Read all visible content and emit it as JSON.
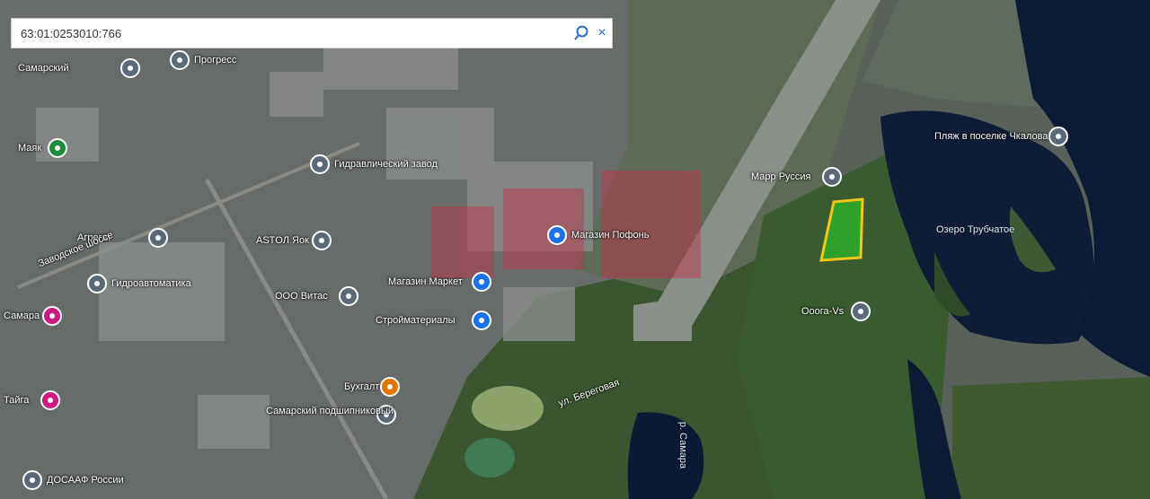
{
  "search": {
    "value": "63:01:0253010:766",
    "clear_symbol": "×"
  },
  "colors": {
    "water": "#0d1d3a",
    "forest": "#2e4a28",
    "industrial": "#6e7376",
    "runway": "#8a8f8a",
    "parcel_fill": "#2fa12a",
    "parcel_border": "#f2c618",
    "watermark": "#c4304a"
  },
  "pois": [
    {
      "label": "Пляж в поселке Чкалова",
      "icon": "pin-icon",
      "kind": "grey"
    },
    {
      "label": "Марр Руссия",
      "icon": "pin-icon",
      "kind": "grey"
    },
    {
      "label": "Озеро Трубчатое",
      "icon": "none",
      "kind": "water"
    },
    {
      "label": "Ооога-Vs",
      "icon": "pin-icon",
      "kind": "grey"
    },
    {
      "label": "Магазин Пофонь",
      "icon": "shopping-icon",
      "kind": "blue"
    },
    {
      "label": "Магазин Маркет",
      "icon": "shopping-icon",
      "kind": "blue"
    },
    {
      "label": "Стройматериалы",
      "icon": "shopping-icon",
      "kind": "blue"
    },
    {
      "label": "Агрегат",
      "icon": "pin-icon",
      "kind": "grey"
    },
    {
      "label": "ASTOЛ Яок",
      "icon": "pin-icon",
      "kind": "grey"
    },
    {
      "label": "Гидроавтоматика",
      "icon": "pin-icon",
      "kind": "grey"
    },
    {
      "label": "ООО Витас",
      "icon": "pin-icon",
      "kind": "grey"
    },
    {
      "label": "Бухгалт",
      "icon": "food-icon",
      "kind": "orange"
    },
    {
      "label": "Самарский подшипниковый",
      "icon": "pin-icon",
      "kind": "grey"
    },
    {
      "label": "Гидравлический завод",
      "icon": "pin-icon",
      "kind": "grey"
    },
    {
      "label": "Маяк",
      "icon": "pin-icon",
      "kind": "green"
    },
    {
      "label": "Самарский",
      "icon": "pin-icon",
      "kind": "grey"
    },
    {
      "label": "Прогресс",
      "icon": "pin-icon",
      "kind": "grey"
    },
    {
      "label": "Заводское шоссе",
      "icon": "none",
      "kind": "road"
    },
    {
      "label": "ул. Береговая",
      "icon": "none",
      "kind": "road"
    },
    {
      "label": "р. Самара",
      "icon": "none",
      "kind": "water"
    },
    {
      "label": "Тайга",
      "icon": "pin-icon",
      "kind": "pink"
    },
    {
      "label": "Самара",
      "icon": "pin-icon",
      "kind": "pink"
    },
    {
      "label": "ДОСААФ России",
      "icon": "pin-icon",
      "kind": "grey"
    }
  ]
}
